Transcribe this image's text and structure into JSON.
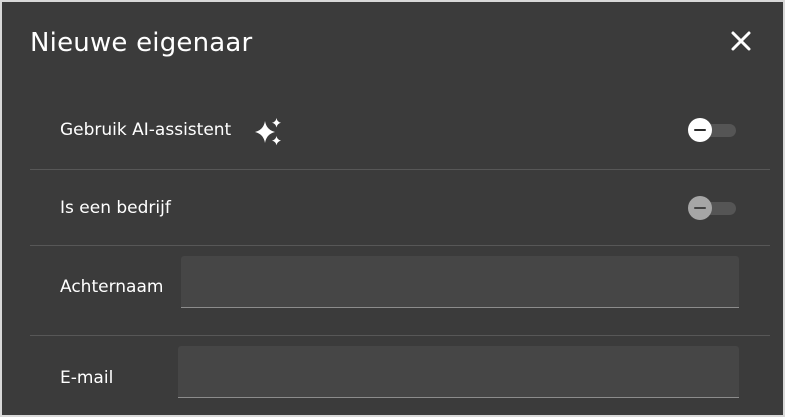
{
  "dialog": {
    "title": "Nieuwe eigenaar",
    "close_icon": "close-icon"
  },
  "form": {
    "ai_assistant": {
      "label": "Gebruik AI-assistent",
      "icon": "sparkles-icon",
      "enabled": false
    },
    "is_company": {
      "label": "Is een bedrijf",
      "enabled": false
    },
    "last_name": {
      "label": "Achternaam",
      "value": ""
    },
    "email": {
      "label": "E-mail",
      "value": ""
    }
  },
  "colors": {
    "dialog_background": "#3b3b3b",
    "input_background": "#464646",
    "divider": "#575757",
    "text": "#ffffff"
  }
}
